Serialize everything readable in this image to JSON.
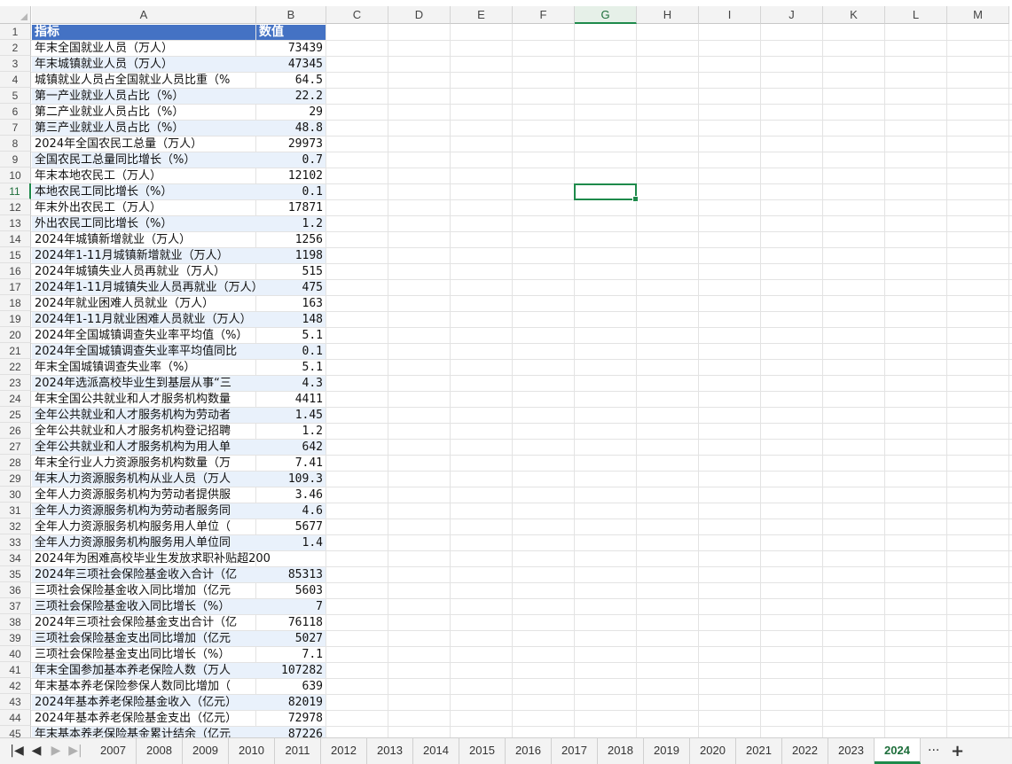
{
  "columns": [
    "A",
    "B",
    "C",
    "D",
    "E",
    "F",
    "G",
    "H",
    "I",
    "J",
    "K",
    "L",
    "M"
  ],
  "selected_column": "G",
  "selected_row": "11",
  "header": {
    "a": "指标",
    "b": "数值"
  },
  "rows": [
    {
      "n": "2",
      "a": "年末全国就业人员（万人）",
      "b": "73439"
    },
    {
      "n": "3",
      "a": "年末城镇就业人员（万人）",
      "b": "47345"
    },
    {
      "n": "4",
      "a": "城镇就业人员占全国就业人员比重（%",
      "b": "64.5"
    },
    {
      "n": "5",
      "a": "第一产业就业人员占比（%）",
      "b": "22.2"
    },
    {
      "n": "6",
      "a": "第二产业就业人员占比（%）",
      "b": "29"
    },
    {
      "n": "7",
      "a": "第三产业就业人员占比（%）",
      "b": "48.8"
    },
    {
      "n": "8",
      "a": "2024年全国农民工总量（万人）",
      "b": "29973"
    },
    {
      "n": "9",
      "a": "全国农民工总量同比增长（%）",
      "b": "0.7"
    },
    {
      "n": "10",
      "a": "年末本地农民工（万人）",
      "b": "12102"
    },
    {
      "n": "11",
      "a": "本地农民工同比增长（%）",
      "b": "0.1"
    },
    {
      "n": "12",
      "a": "年末外出农民工（万人）",
      "b": "17871"
    },
    {
      "n": "13",
      "a": "外出农民工同比增长（%）",
      "b": "1.2"
    },
    {
      "n": "14",
      "a": "2024年城镇新增就业（万人）",
      "b": "1256"
    },
    {
      "n": "15",
      "a": "2024年1-11月城镇新增就业（万人）",
      "b": "1198"
    },
    {
      "n": "16",
      "a": "2024年城镇失业人员再就业（万人）",
      "b": "515"
    },
    {
      "n": "17",
      "a": "2024年1-11月城镇失业人员再就业（万人）",
      "b": "475"
    },
    {
      "n": "18",
      "a": "2024年就业困难人员就业（万人）",
      "b": "163"
    },
    {
      "n": "19",
      "a": "2024年1-11月就业困难人员就业（万人）",
      "b": "148"
    },
    {
      "n": "20",
      "a": "2024年全国城镇调查失业率平均值（%）",
      "b": "5.1"
    },
    {
      "n": "21",
      "a": "2024年全国城镇调查失业率平均值同比",
      "b": "0.1"
    },
    {
      "n": "22",
      "a": "年末全国城镇调查失业率（%）",
      "b": "5.1"
    },
    {
      "n": "23",
      "a": "2024年选派高校毕业生到基层从事“三",
      "b": "4.3"
    },
    {
      "n": "24",
      "a": "年末全国公共就业和人才服务机构数量",
      "b": "4411"
    },
    {
      "n": "25",
      "a": "全年公共就业和人才服务机构为劳动者",
      "b": "1.45"
    },
    {
      "n": "26",
      "a": "全年公共就业和人才服务机构登记招聘",
      "b": "1.2"
    },
    {
      "n": "27",
      "a": "全年公共就业和人才服务机构为用人单",
      "b": "642"
    },
    {
      "n": "28",
      "a": "年末全行业人力资源服务机构数量（万",
      "b": "7.41"
    },
    {
      "n": "29",
      "a": "年末人力资源服务机构从业人员（万人",
      "b": "109.3"
    },
    {
      "n": "30",
      "a": "全年人力资源服务机构为劳动者提供服",
      "b": "3.46"
    },
    {
      "n": "31",
      "a": "全年人力资源服务机构为劳动者服务同",
      "b": "4.6"
    },
    {
      "n": "32",
      "a": "全年人力资源服务机构服务用人单位（",
      "b": "5677"
    },
    {
      "n": "33",
      "a": "全年人力资源服务机构服务用人单位同",
      "b": "1.4"
    },
    {
      "n": "34",
      "a": "2024年为困难高校毕业生发放求职补贴超200",
      "b": ""
    },
    {
      "n": "35",
      "a": "2024年三项社会保险基金收入合计（亿",
      "b": "85313"
    },
    {
      "n": "36",
      "a": "三项社会保险基金收入同比增加（亿元",
      "b": "5603"
    },
    {
      "n": "37",
      "a": "三项社会保险基金收入同比增长（%）",
      "b": "7"
    },
    {
      "n": "38",
      "a": "2024年三项社会保险基金支出合计（亿",
      "b": "76118"
    },
    {
      "n": "39",
      "a": "三项社会保险基金支出同比增加（亿元",
      "b": "5027"
    },
    {
      "n": "40",
      "a": "三项社会保险基金支出同比增长（%）",
      "b": "7.1"
    },
    {
      "n": "41",
      "a": "年末全国参加基本养老保险人数（万人",
      "b": "107282"
    },
    {
      "n": "42",
      "a": "年末基本养老保险参保人数同比增加（",
      "b": "639"
    },
    {
      "n": "43",
      "a": "2024年基本养老保险基金收入（亿元）",
      "b": "82019"
    },
    {
      "n": "44",
      "a": "2024年基本养老保险基金支出（亿元）",
      "b": "72978"
    },
    {
      "n": "45",
      "a": "年末基本养老保险基金累计结余（亿元",
      "b": "87226"
    }
  ],
  "sheet_tabs": [
    "2007",
    "2008",
    "2009",
    "2010",
    "2011",
    "2012",
    "2013",
    "2014",
    "2015",
    "2016",
    "2017",
    "2018",
    "2019",
    "2020",
    "2021",
    "2022",
    "2023",
    "2024"
  ],
  "active_tab": "2024",
  "icons": {
    "first": "first-sheet-icon",
    "prev": "prev-sheet-icon",
    "next": "next-sheet-icon",
    "last": "last-sheet-icon",
    "more": "more-sheets-icon",
    "add": "add-sheet-icon"
  },
  "colors": {
    "header_fill": "#4472c4",
    "band_fill": "#e9f1fb",
    "accent": "#1e8a4b"
  },
  "glyphs": {
    "first": "|◀",
    "prev": "◀",
    "next": "▶",
    "last": "▶|",
    "more": "···",
    "add": "+"
  }
}
